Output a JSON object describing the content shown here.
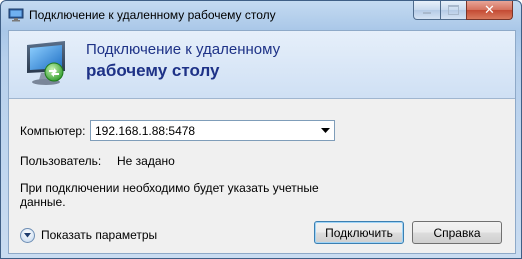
{
  "window": {
    "title": "Подключение к удаленному рабочему столу",
    "icon": "remote-desktop-icon",
    "controls": {
      "minimize": "minimize-icon",
      "maximize": "maximize-icon",
      "close_label": "✕"
    }
  },
  "banner": {
    "icon": "remote-desktop-monitor-icon",
    "line1": "Подключение к удаленному",
    "line2": "рабочему столу"
  },
  "form": {
    "computer_label": "Компьютер:",
    "computer_value": "192.168.1.88:5478",
    "user_label": "Пользователь:",
    "user_value": "Не задано",
    "notice_line1": "При подключении необходимо будет указать учетные",
    "notice_line2": "данные."
  },
  "footer": {
    "options_label": "Показать параметры",
    "connect_label": "Подключить",
    "help_label": "Справка"
  },
  "colors": {
    "banner_text": "#1e3287",
    "frame": "#a9c7e8",
    "close_button": "#c44a33"
  }
}
